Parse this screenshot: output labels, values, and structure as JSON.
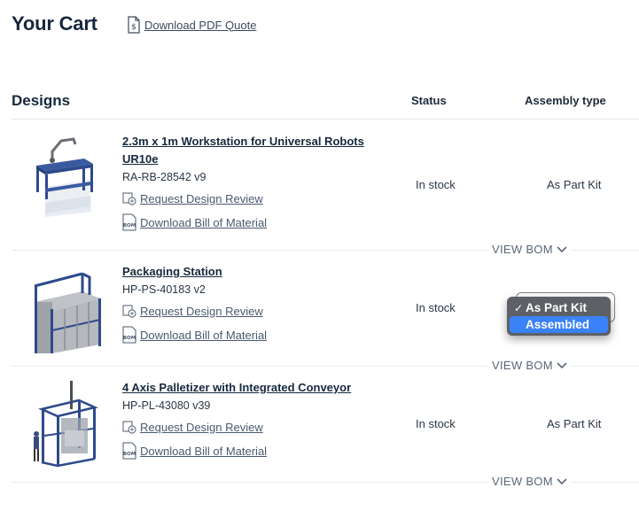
{
  "header": {
    "title": "Your Cart",
    "pdf_link": "Download PDF Quote"
  },
  "table": {
    "section_title": "Designs",
    "col_status": "Status",
    "col_assembly": "Assembly type"
  },
  "items": [
    {
      "title": "2.3m x 1m Workstation for Universal Robots UR10e",
      "sku": "RA-RB-28542 v9",
      "review_label": "Request Design Review",
      "bom_label": "Download Bill of Material",
      "status": "In stock",
      "assembly": "As Part Kit",
      "view_bom": "VIEW BOM"
    },
    {
      "title": "Packaging Station",
      "sku": "HP-PS-40183 v2",
      "review_label": "Request Design Review",
      "bom_label": "Download Bill of Material",
      "status": "In stock",
      "assembly": "",
      "view_bom": "VIEW BOM"
    },
    {
      "title": "4 Axis Palletizer with Integrated Conveyor",
      "sku": "HP-PL-43080 v39",
      "review_label": "Request Design Review",
      "bom_label": "Download Bill of Material",
      "status": "In stock",
      "assembly": "As Part Kit",
      "view_bom": "VIEW BOM"
    }
  ],
  "assembly_dropdown": {
    "options": [
      "As Part Kit",
      "Assembled"
    ],
    "checked": "As Part Kit",
    "highlighted": "Assembled"
  },
  "colors": {
    "frame_blue": "#2d4a8c",
    "menu_bg": "#5d6166",
    "highlight": "#3a82f7"
  }
}
